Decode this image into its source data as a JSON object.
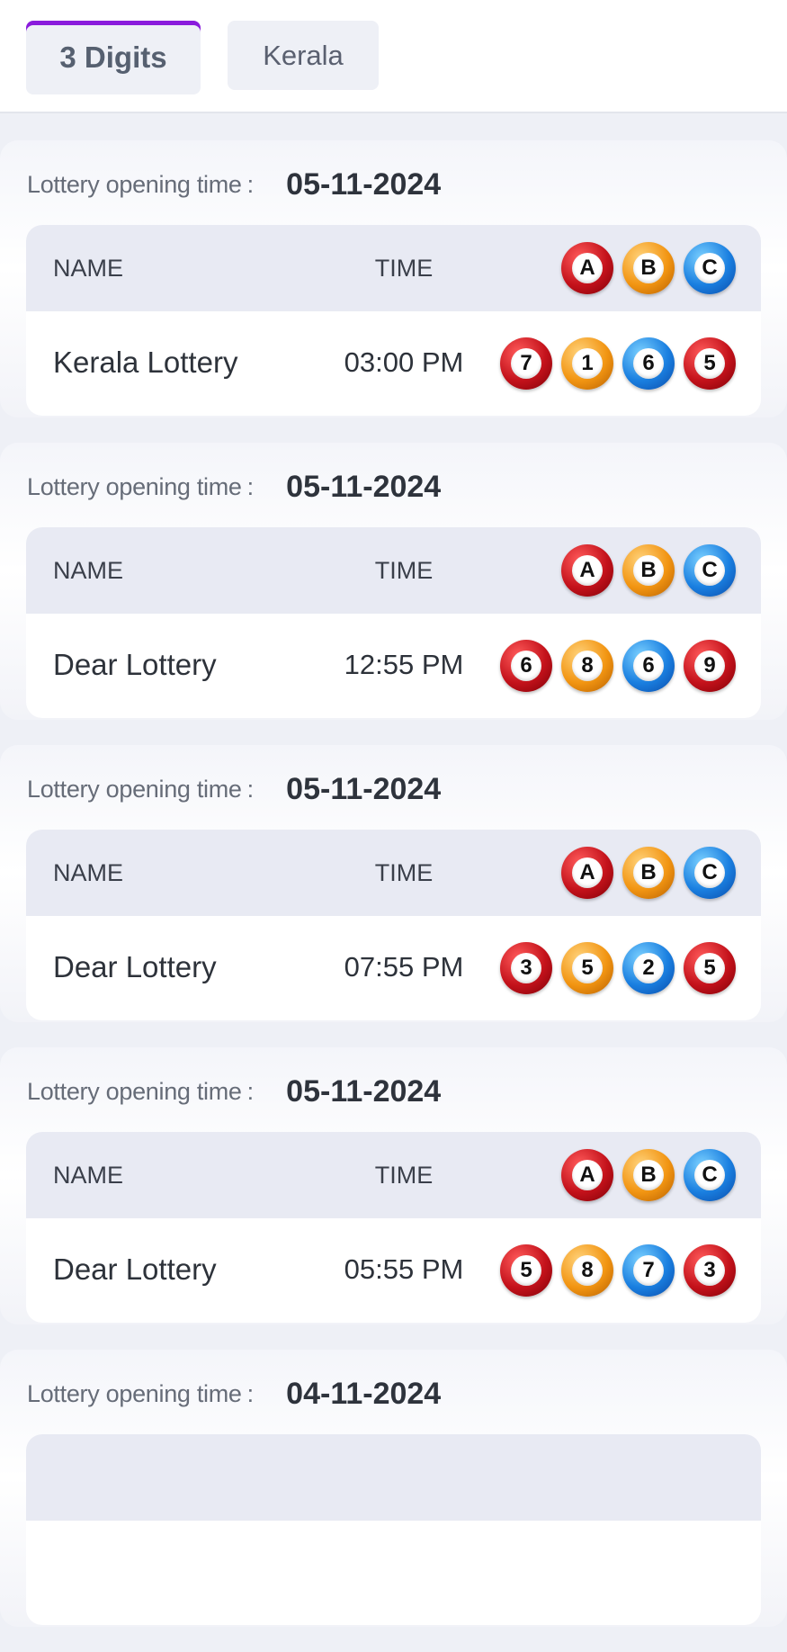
{
  "tabs": {
    "active_label": "3 Digits",
    "other_label": "Kerala"
  },
  "colors": {
    "tab_indicator": "#8a1bdc",
    "ball_first": "#c4121b",
    "ball_second": "#f29512",
    "ball_third": "#1a7fe0",
    "ball_fourth": "#c4121b"
  },
  "labels": {
    "opening_time": "Lottery opening time",
    "colon": ":",
    "name_header": "NAME",
    "time_header": "TIME",
    "col_a": "A",
    "col_b": "B",
    "col_c": "C"
  },
  "results": [
    {
      "date": "05-11-2024",
      "name": "Kerala Lottery",
      "time": "03:00 PM",
      "numbers": [
        "7",
        "1",
        "6",
        "5"
      ]
    },
    {
      "date": "05-11-2024",
      "name": "Dear Lottery",
      "time": "12:55 PM",
      "numbers": [
        "6",
        "8",
        "6",
        "9"
      ]
    },
    {
      "date": "05-11-2024",
      "name": "Dear Lottery",
      "time": "07:55 PM",
      "numbers": [
        "3",
        "5",
        "2",
        "5"
      ]
    },
    {
      "date": "05-11-2024",
      "name": "Dear Lottery",
      "time": "05:55 PM",
      "numbers": [
        "5",
        "8",
        "7",
        "3"
      ]
    },
    {
      "date": "04-11-2024"
    }
  ]
}
